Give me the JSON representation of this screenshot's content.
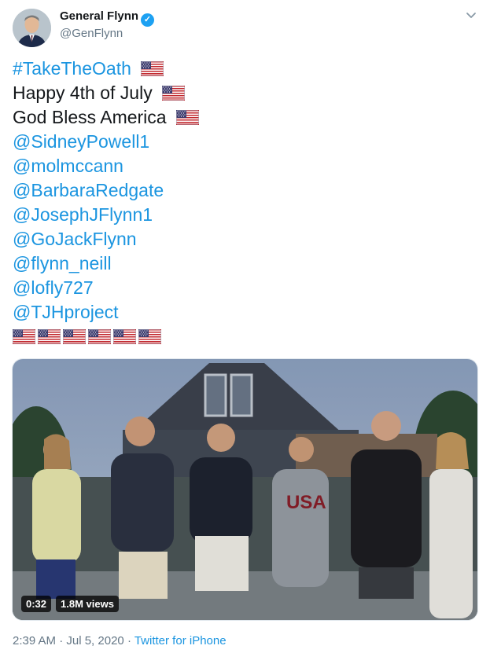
{
  "author": {
    "name": "General Flynn",
    "handle": "@GenFlynn"
  },
  "tweet": {
    "hashtag": "#TakeTheOath",
    "line2": "Happy 4th of July",
    "line3": "God Bless America",
    "mentions": [
      "@SidneyPowell1",
      "@molmccann",
      "@BarbaraRedgate",
      "@JosephJFlynn1",
      "@GoJackFlynn",
      "@flynn_neill",
      "@lofly727",
      "@TJHproject"
    ],
    "flag_count": 6
  },
  "video": {
    "duration": "0:32",
    "views": "1.8M views",
    "shirt_text": "USA"
  },
  "meta": {
    "timestamp": "2:39 AM · Jul 5, 2020",
    "separator": "·",
    "source": "Twitter for iPhone"
  },
  "colors": {
    "link": "#1b95e0",
    "verified": "#1da1f2",
    "secondary": "#657786"
  },
  "icons": [
    "verified-badge-icon",
    "chevron-down-icon",
    "us-flag-icon"
  ]
}
